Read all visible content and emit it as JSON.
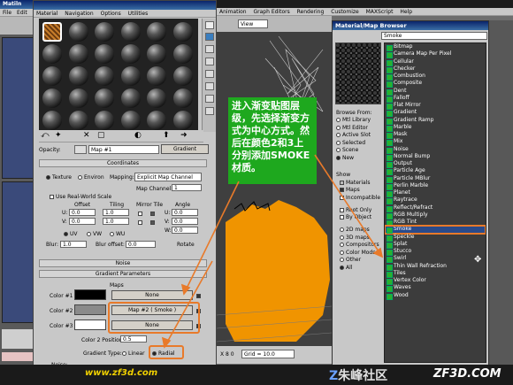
{
  "left_app": {
    "title": "Matiln",
    "menu": [
      "File",
      "Edit"
    ]
  },
  "main_app": {
    "menu": [
      "Animation",
      "Graph Editors",
      "Rendering",
      "Customize",
      "MAXScript",
      "Help"
    ],
    "viewport_dropdown": "View",
    "grid_label": "Grid = 10.0",
    "frame_coords": "X 8 0"
  },
  "material_editor": {
    "menu": [
      "Material",
      "Navigation",
      "Options",
      "Utilities"
    ],
    "opacity_label": "Opacity:",
    "map_name": "Map #1",
    "map_type": "Gradient",
    "coordinates": {
      "title": "Coordinates",
      "texture": "Texture",
      "environ": "Environ",
      "mapping_label": "Mapping:",
      "mapping_value": "Explicit Map Channel",
      "map_channel_label": "Map Channel:",
      "map_channel_value": "1",
      "realworld_label": "Use Real-World Scale",
      "offset_label": "Offset",
      "tiling_label": "Tiling",
      "mirror_tile_label": "Mirror Tile",
      "angle_label": "Angle",
      "u_label": "U:",
      "v_label": "V:",
      "w_label": "W:",
      "u_offset": "0.0",
      "v_offset": "0.0",
      "u_tiling": "1.0",
      "v_tiling": "1.0",
      "u_angle": "0.0",
      "v_angle": "0.0",
      "w_angle": "0.0",
      "uv": "UV",
      "vw": "VW",
      "wu": "WU",
      "blur_label": "Blur:",
      "blur_value": "1.0",
      "blur_offset_label": "Blur offset:",
      "blur_offset_value": "0.0",
      "rotate": "Rotate"
    },
    "noise_title": "Noise",
    "gradient_params": {
      "title": "Gradient Parameters",
      "maps_label": "Maps",
      "color1_label": "Color #1",
      "color2_label": "Color #2",
      "color3_label": "Color #3",
      "color1_map": "None",
      "color2_map": "Map #2 ( Smoke )",
      "color3_map": "None",
      "color1_hex": "#000000",
      "color2_hex": "#8a8a8a",
      "color3_hex": "#ffffff",
      "color2_position_label": "Color 2 Position:",
      "color2_position_value": "0.5",
      "gradient_type_label": "Gradient Type:",
      "linear": "Linear",
      "radial": "Radial",
      "noise_label": "Noise:"
    }
  },
  "annotation": {
    "text": "进入渐变贴图层级，先选择渐变方式为中心方式。然后在颜色2和3上分别添加SMOKE材质。",
    "bg_color": "#1ea81e",
    "text_color": "#ffffff"
  },
  "browser": {
    "title": "Material/Map Browser",
    "search_value": "Smoke",
    "browse_from_label": "Browse From:",
    "browse_from": [
      "Mtl Library",
      "Mtl Editor",
      "Active Slot",
      "Selected",
      "Scene",
      "New"
    ],
    "browse_from_selected": "New",
    "show_label": "Show",
    "show_options": [
      "Materials",
      "Maps",
      "Incompatible"
    ],
    "root_only": "Root Only",
    "by_object": "By Object",
    "map_categories": [
      "2D maps",
      "3D maps",
      "Compositors",
      "Color Mods",
      "Other",
      "All"
    ],
    "map_category_selected": "All",
    "items": [
      "Bitmap",
      "Camera Map Per Pixel",
      "Cellular",
      "Checker",
      "Combustion",
      "Composite",
      "Dent",
      "Falloff",
      "Flat Mirror",
      "Gradient",
      "Gradient Ramp",
      "Marble",
      "Mask",
      "Mix",
      "Noise",
      "Normal Bump",
      "Output",
      "Particle Age",
      "Particle MBlur",
      "Perlin Marble",
      "Planet",
      "Raytrace",
      "Reflect/Refract",
      "RGB Multiply",
      "RGB Tint",
      "Smoke",
      "Speckle",
      "Splat",
      "Stucco",
      "Swirl",
      "Thin Wall Refraction",
      "Tiles",
      "Vertex Color",
      "Waves",
      "Wood"
    ],
    "selected_item": "Smoke"
  },
  "watermark": {
    "url": "www.zf3d.com",
    "brand": "朱峰社区",
    "brand_logo_char": "Z",
    "domain": "ZF3D.COM"
  },
  "colors": {
    "accent_orange": "#e87a2a",
    "list_bg": "#3c3c3c",
    "viewport_orange": "#f09400"
  }
}
